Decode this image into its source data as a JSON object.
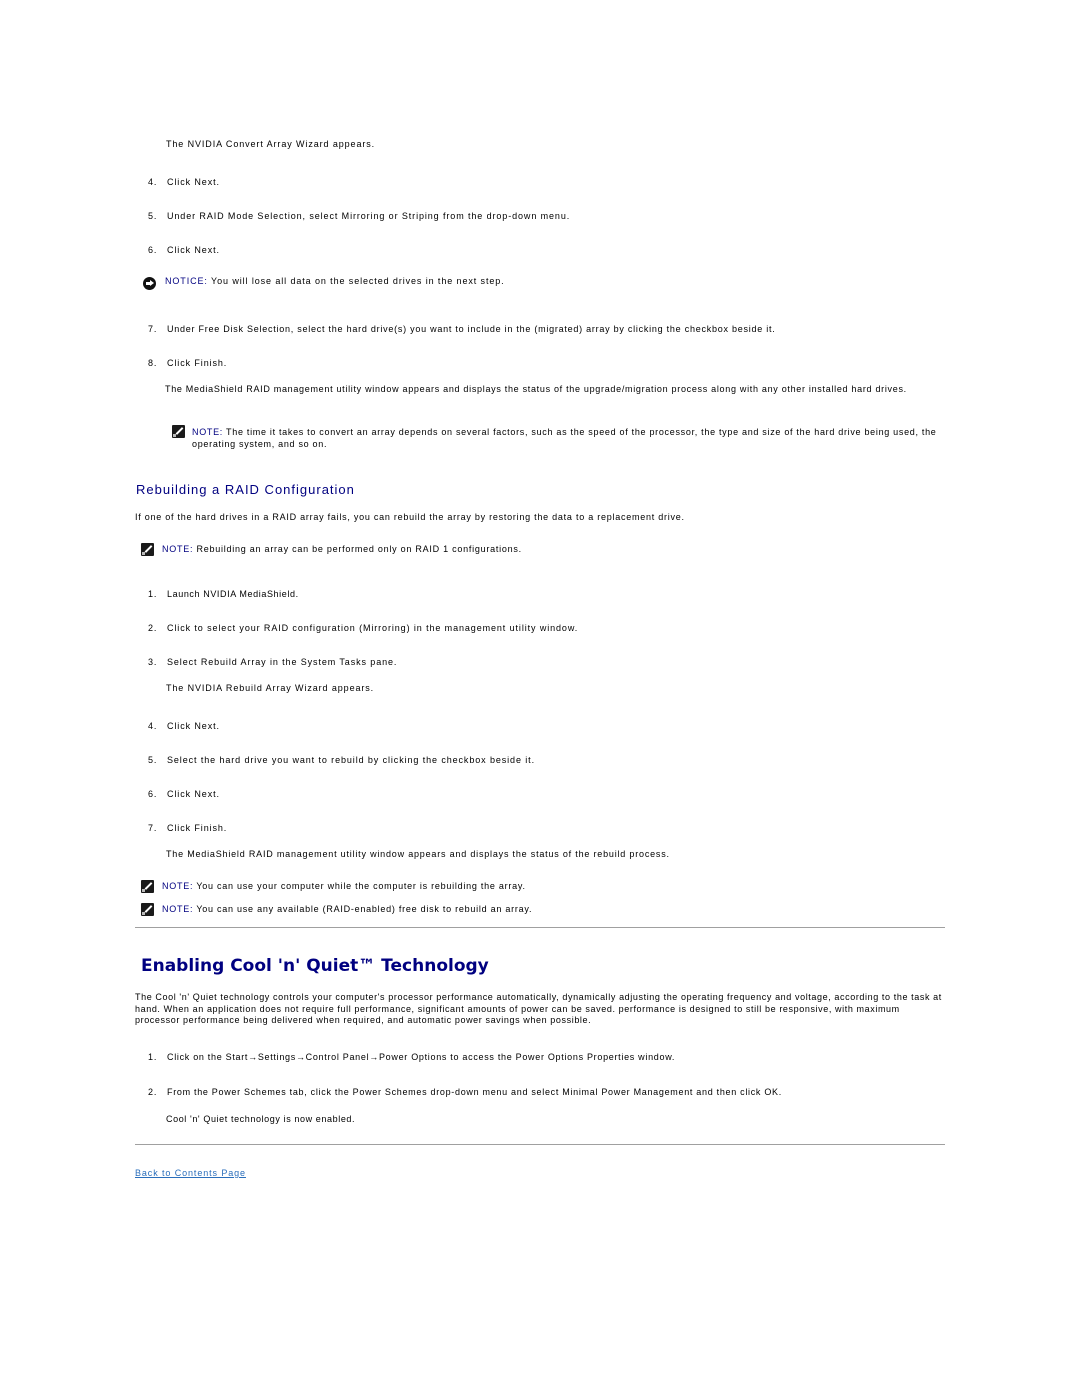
{
  "section1": {
    "intro_result": "The NVIDIA Convert Array Wizard appears.",
    "steps": [
      {
        "num": "4.",
        "text": "Click Next."
      },
      {
        "num": "5.",
        "text": "Under RAID Mode Selection, select Mirroring or Striping from the drop-down menu."
      },
      {
        "num": "6.",
        "text": "Click Next."
      }
    ],
    "notice": {
      "label": "NOTICE:",
      "text": " You will lose all data on the selected drives in the next step."
    },
    "steps2": [
      {
        "num": "7.",
        "text": "Under Free Disk Selection, select the hard drive(s) you want to include in the (migrated) array by clicking the checkbox beside it."
      },
      {
        "num": "8.",
        "text": "Click Finish."
      }
    ],
    "result": "The MediaShield RAID management utility window appears and displays the status of the upgrade/migration process along with any other installed hard drives.",
    "note": {
      "label": "NOTE:",
      "text": " The time it takes to convert an array depends on several factors, such as the speed of the processor, the type and size of the hard drive being used, the operating system, and so on."
    }
  },
  "section2": {
    "heading": "Rebuilding a RAID Configuration",
    "intro": "If one of the hard drives in a RAID array fails, you can rebuild the array by restoring the data to a replacement drive.",
    "note": {
      "label": "NOTE:",
      "text": " Rebuilding an array can be performed only on RAID 1 configurations."
    },
    "steps": [
      {
        "num": "1.",
        "text": "Launch NVIDIA MediaShield."
      },
      {
        "num": "2.",
        "text": "Click to select your RAID configuration (Mirroring) in the management utility window."
      },
      {
        "num": "3.",
        "text": "Select Rebuild Array in the System Tasks pane."
      }
    ],
    "step3_result": "The NVIDIA Rebuild Array Wizard appears.",
    "steps2": [
      {
        "num": "4.",
        "text": "Click Next."
      },
      {
        "num": "5.",
        "text": "Select the hard drive you want to rebuild by clicking the checkbox beside it."
      },
      {
        "num": "6.",
        "text": "Click Next."
      },
      {
        "num": "7.",
        "text": "Click Finish."
      }
    ],
    "result": "The MediaShield RAID management utility window appears and displays the status of the rebuild process.",
    "notes": [
      {
        "label": "NOTE:",
        "text": " You can use your computer while the computer is rebuilding the array."
      },
      {
        "label": "NOTE:",
        "text": " You can use any available (RAID-enabled) free disk to rebuild an array."
      }
    ]
  },
  "section3": {
    "heading": "Enabling Cool 'n' Quiet™ Technology",
    "intro": "The Cool 'n' Quiet technology controls your computer's processor performance automatically, dynamically adjusting the operating frequency and voltage, according to the task at hand. When an application does not require full performance, significant amounts of power can be saved. performance is designed to still be responsive, with maximum processor performance being delivered when required, and automatic power savings when possible.",
    "steps": [
      {
        "num": "1.",
        "text": "Click on the Start→Settings→Control Panel→Power Options to access the Power Options Properties window."
      },
      {
        "num": "2.",
        "text": "From the Power Schemes tab, click the Power Schemes drop-down menu and select Minimal Power Management and then click OK."
      }
    ],
    "result": "Cool 'n' Quiet technology is now enabled."
  },
  "footer": {
    "back_link": "Back to Contents Page"
  }
}
